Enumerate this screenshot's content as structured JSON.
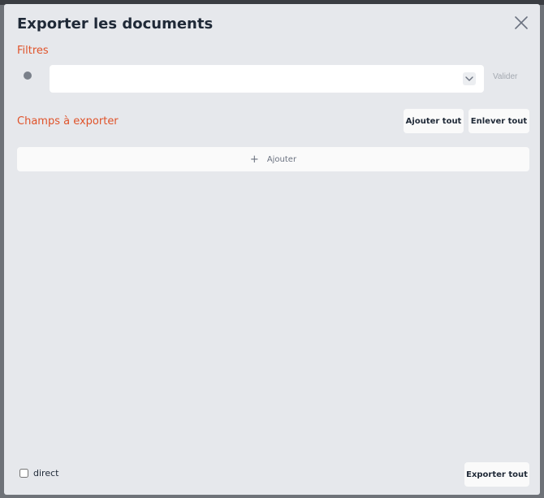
{
  "modal": {
    "title": "Exporter les documents",
    "close_icon": "close-icon"
  },
  "filters": {
    "label": "Filtres",
    "select_value": "",
    "validate_label": "Valider",
    "chevron_icon": "chevron-down-icon"
  },
  "fields": {
    "label": "Champs à exporter",
    "add_all_label": "Ajouter tout",
    "remove_all_label": "Enlever tout",
    "add_label": "Ajouter",
    "add_icon": "plus-icon"
  },
  "footer": {
    "direct_label": "direct",
    "direct_checked": false,
    "export_all_label": "Exporter tout"
  },
  "colors": {
    "accent": "#e0532a",
    "modal_bg": "#e6e8ec",
    "title_text": "#1f2937",
    "muted_text": "#a3a8b0"
  }
}
